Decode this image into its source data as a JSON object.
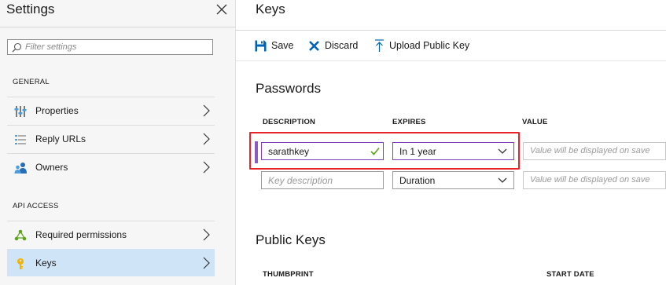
{
  "settings": {
    "title": "Settings",
    "filter_placeholder": "Filter settings",
    "general_label": "GENERAL",
    "general_items": [
      {
        "label": "Properties",
        "icon": "properties-icon"
      },
      {
        "label": "Reply URLs",
        "icon": "list-icon"
      },
      {
        "label": "Owners",
        "icon": "owners-icon"
      }
    ],
    "api_label": "API ACCESS",
    "api_items": [
      {
        "label": "Required permissions",
        "icon": "permissions-icon"
      },
      {
        "label": "Keys",
        "icon": "key-icon",
        "selected": true
      }
    ]
  },
  "keys": {
    "title": "Keys",
    "toolbar": {
      "save": "Save",
      "discard": "Discard",
      "upload": "Upload Public Key"
    },
    "passwords": {
      "title": "Passwords",
      "columns": [
        "DESCRIPTION",
        "EXPIRES",
        "VALUE"
      ],
      "rows": [
        {
          "description": "sarathkey",
          "expires": "In 1 year",
          "value_placeholder": "Value will be displayed on save"
        },
        {
          "description_placeholder": "Key description",
          "expires": "Duration",
          "value_placeholder": "Value will be displayed on save"
        }
      ]
    },
    "public_keys": {
      "title": "Public Keys",
      "columns": [
        "THUMBPRINT",
        "START DATE"
      ]
    }
  },
  "colors": {
    "accent": "#0078d4",
    "selected_bg": "#cfe4f7",
    "highlight": "#e8232a",
    "row_accent": "#8a5cc2",
    "check": "#5ea51e"
  }
}
